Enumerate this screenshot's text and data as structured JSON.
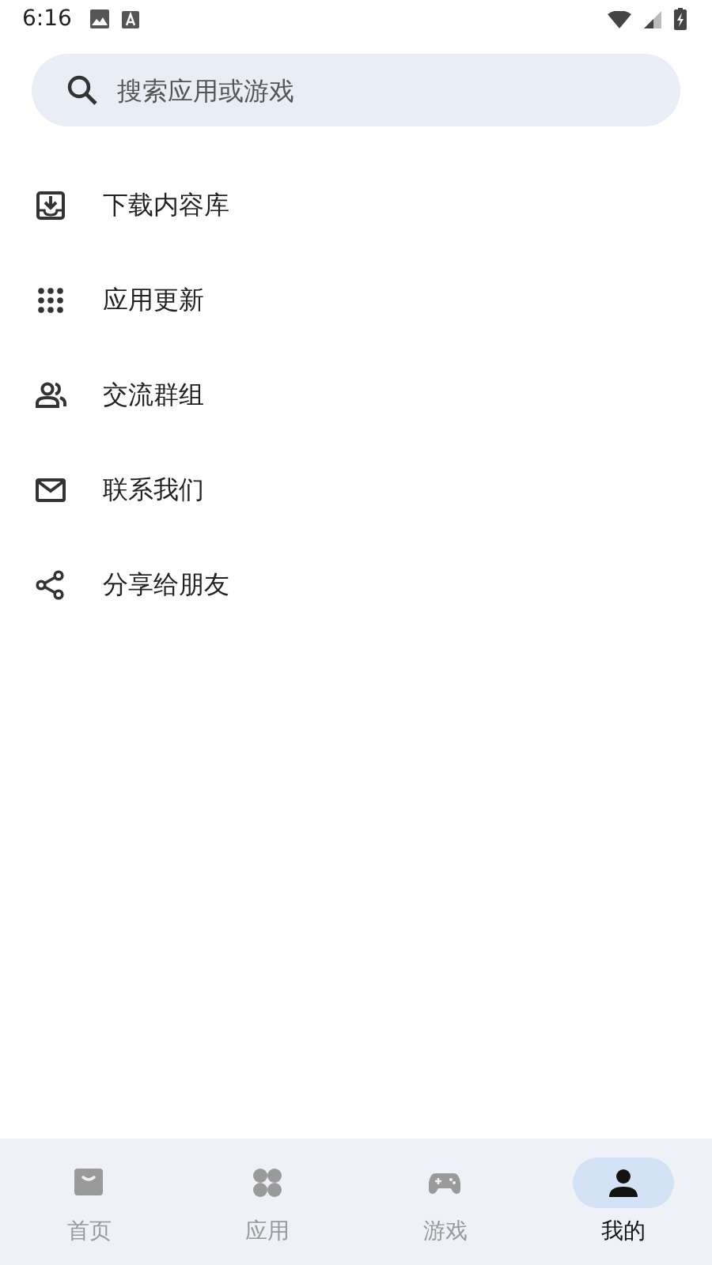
{
  "status_bar": {
    "time": "6:16"
  },
  "search": {
    "placeholder": "搜索应用或游戏"
  },
  "menu": [
    {
      "label": "下载内容库"
    },
    {
      "label": "应用更新"
    },
    {
      "label": "交流群组"
    },
    {
      "label": "联系我们"
    },
    {
      "label": "分享给朋友"
    }
  ],
  "bottom_nav": [
    {
      "label": "首页",
      "selected": false
    },
    {
      "label": "应用",
      "selected": false
    },
    {
      "label": "游戏",
      "selected": false
    },
    {
      "label": "我的",
      "selected": true
    }
  ]
}
